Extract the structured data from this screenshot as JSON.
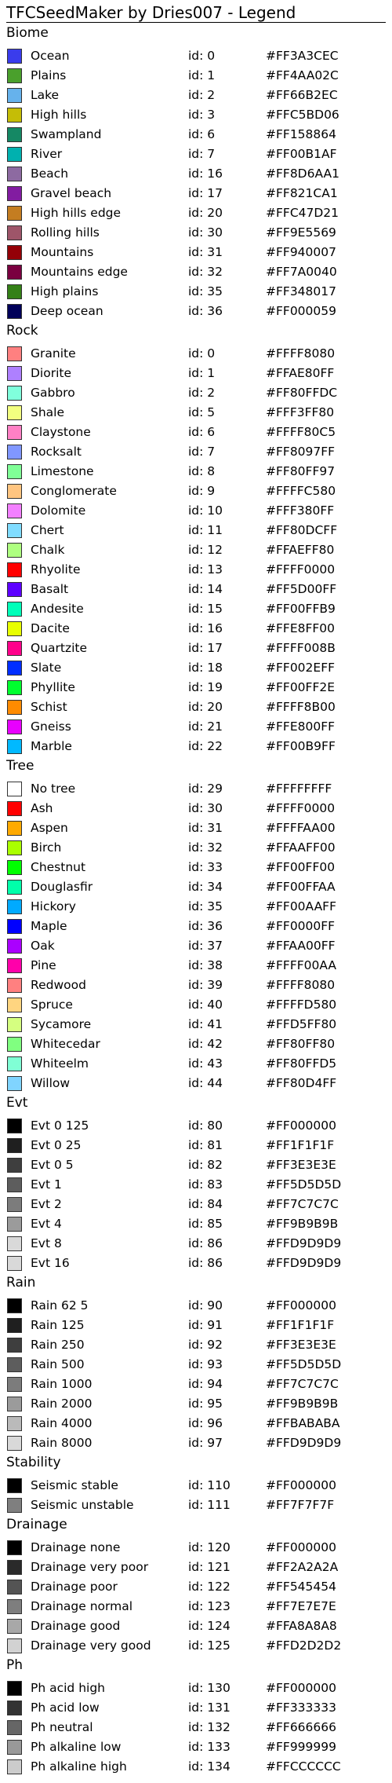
{
  "title": "TFCSeedMaker by Dries007 - Legend",
  "sections": [
    {
      "name": "Biome",
      "items": [
        {
          "name": "Ocean",
          "id": "id: 0",
          "hex": "#FF3A3CEC",
          "color": "#3A3CEC"
        },
        {
          "name": "Plains",
          "id": "id: 1",
          "hex": "#FF4AA02C",
          "color": "#4AA02C"
        },
        {
          "name": "Lake",
          "id": "id: 2",
          "hex": "#FF66B2EC",
          "color": "#66B2EC"
        },
        {
          "name": "High hills",
          "id": "id: 3",
          "hex": "#FFC5BD06",
          "color": "#C5BD06"
        },
        {
          "name": "Swampland",
          "id": "id: 6",
          "hex": "#FF158864",
          "color": "#158864"
        },
        {
          "name": "River",
          "id": "id: 7",
          "hex": "#FF00B1AF",
          "color": "#00B1AF"
        },
        {
          "name": "Beach",
          "id": "id: 16",
          "hex": "#FF8D6AA1",
          "color": "#8D6AA1"
        },
        {
          "name": "Gravel beach",
          "id": "id: 17",
          "hex": "#FF821CA1",
          "color": "#821CA1"
        },
        {
          "name": "High hills edge",
          "id": "id: 20",
          "hex": "#FFC47D21",
          "color": "#C47D21"
        },
        {
          "name": "Rolling hills",
          "id": "id: 30",
          "hex": "#FF9E5569",
          "color": "#9E5569"
        },
        {
          "name": "Mountains",
          "id": "id: 31",
          "hex": "#FF940007",
          "color": "#940007"
        },
        {
          "name": "Mountains edge",
          "id": "id: 32",
          "hex": "#FF7A0040",
          "color": "#7A0040"
        },
        {
          "name": "High plains",
          "id": "id: 35",
          "hex": "#FF348017",
          "color": "#348017"
        },
        {
          "name": "Deep ocean",
          "id": "id: 36",
          "hex": "#FF000059",
          "color": "#000059"
        }
      ]
    },
    {
      "name": "Rock",
      "items": [
        {
          "name": "Granite",
          "id": "id: 0",
          "hex": "#FFFF8080",
          "color": "#FF8080"
        },
        {
          "name": "Diorite",
          "id": "id: 1",
          "hex": "#FFAE80FF",
          "color": "#AE80FF"
        },
        {
          "name": "Gabbro",
          "id": "id: 2",
          "hex": "#FF80FFDC",
          "color": "#80FFDC"
        },
        {
          "name": "Shale",
          "id": "id: 5",
          "hex": "#FFF3FF80",
          "color": "#F3FF80"
        },
        {
          "name": "Claystone",
          "id": "id: 6",
          "hex": "#FFFF80C5",
          "color": "#FF80C5"
        },
        {
          "name": "Rocksalt",
          "id": "id: 7",
          "hex": "#FF8097FF",
          "color": "#8097FF"
        },
        {
          "name": "Limestone",
          "id": "id: 8",
          "hex": "#FF80FF97",
          "color": "#80FF97"
        },
        {
          "name": "Conglomerate",
          "id": "id: 9",
          "hex": "#FFFFC580",
          "color": "#FFC580"
        },
        {
          "name": "Dolomite",
          "id": "id: 10",
          "hex": "#FFF380FF",
          "color": "#F380FF"
        },
        {
          "name": "Chert",
          "id": "id: 11",
          "hex": "#FF80DCFF",
          "color": "#80DCFF"
        },
        {
          "name": "Chalk",
          "id": "id: 12",
          "hex": "#FFAEFF80",
          "color": "#AEFF80"
        },
        {
          "name": "Rhyolite",
          "id": "id: 13",
          "hex": "#FFFF0000",
          "color": "#FF0000"
        },
        {
          "name": "Basalt",
          "id": "id: 14",
          "hex": "#FF5D00FF",
          "color": "#5D00FF"
        },
        {
          "name": "Andesite",
          "id": "id: 15",
          "hex": "#FF00FFB9",
          "color": "#00FFB9"
        },
        {
          "name": "Dacite",
          "id": "id: 16",
          "hex": "#FFE8FF00",
          "color": "#E8FF00"
        },
        {
          "name": "Quartzite",
          "id": "id: 17",
          "hex": "#FFFF008B",
          "color": "#FF008B"
        },
        {
          "name": "Slate",
          "id": "id: 18",
          "hex": "#FF002EFF",
          "color": "#002EFF"
        },
        {
          "name": "Phyllite",
          "id": "id: 19",
          "hex": "#FF00FF2E",
          "color": "#00FF2E"
        },
        {
          "name": "Schist",
          "id": "id: 20",
          "hex": "#FFFF8B00",
          "color": "#FF8B00"
        },
        {
          "name": "Gneiss",
          "id": "id: 21",
          "hex": "#FFE800FF",
          "color": "#E800FF"
        },
        {
          "name": "Marble",
          "id": "id: 22",
          "hex": "#FF00B9FF",
          "color": "#00B9FF"
        }
      ]
    },
    {
      "name": "Tree",
      "items": [
        {
          "name": "No tree",
          "id": "id: 29",
          "hex": "#FFFFFFFF",
          "color": "#FFFFFF"
        },
        {
          "name": "Ash",
          "id": "id: 30",
          "hex": "#FFFF0000",
          "color": "#FF0000"
        },
        {
          "name": "Aspen",
          "id": "id: 31",
          "hex": "#FFFFAA00",
          "color": "#FFAA00"
        },
        {
          "name": "Birch",
          "id": "id: 32",
          "hex": "#FFAAFF00",
          "color": "#AAFF00"
        },
        {
          "name": "Chestnut",
          "id": "id: 33",
          "hex": "#FF00FF00",
          "color": "#00FF00"
        },
        {
          "name": "Douglasfir",
          "id": "id: 34",
          "hex": "#FF00FFAA",
          "color": "#00FFAA"
        },
        {
          "name": "Hickory",
          "id": "id: 35",
          "hex": "#FF00AAFF",
          "color": "#00AAFF"
        },
        {
          "name": "Maple",
          "id": "id: 36",
          "hex": "#FF0000FF",
          "color": "#0000FF"
        },
        {
          "name": "Oak",
          "id": "id: 37",
          "hex": "#FFAA00FF",
          "color": "#AA00FF"
        },
        {
          "name": "Pine",
          "id": "id: 38",
          "hex": "#FFFF00AA",
          "color": "#FF00AA"
        },
        {
          "name": "Redwood",
          "id": "id: 39",
          "hex": "#FFFF8080",
          "color": "#FF8080"
        },
        {
          "name": "Spruce",
          "id": "id: 40",
          "hex": "#FFFFD580",
          "color": "#FFD580"
        },
        {
          "name": "Sycamore",
          "id": "id: 41",
          "hex": "#FFD5FF80",
          "color": "#D5FF80"
        },
        {
          "name": "Whitecedar",
          "id": "id: 42",
          "hex": "#FF80FF80",
          "color": "#80FF80"
        },
        {
          "name": "Whiteelm",
          "id": "id: 43",
          "hex": "#FF80FFD5",
          "color": "#80FFD5"
        },
        {
          "name": "Willow",
          "id": "id: 44",
          "hex": "#FF80D4FF",
          "color": "#80D4FF"
        }
      ]
    },
    {
      "name": "Evt",
      "items": [
        {
          "name": "Evt 0 125",
          "id": "id: 80",
          "hex": "#FF000000",
          "color": "#000000"
        },
        {
          "name": "Evt 0 25",
          "id": "id: 81",
          "hex": "#FF1F1F1F",
          "color": "#1F1F1F"
        },
        {
          "name": "Evt 0 5",
          "id": "id: 82",
          "hex": "#FF3E3E3E",
          "color": "#3E3E3E"
        },
        {
          "name": "Evt 1",
          "id": "id: 83",
          "hex": "#FF5D5D5D",
          "color": "#5D5D5D"
        },
        {
          "name": "Evt 2",
          "id": "id: 84",
          "hex": "#FF7C7C7C",
          "color": "#7C7C7C"
        },
        {
          "name": "Evt 4",
          "id": "id: 85",
          "hex": "#FF9B9B9B",
          "color": "#9B9B9B"
        },
        {
          "name": "Evt 8",
          "id": "id: 86",
          "hex": "#FFD9D9D9",
          "color": "#D9D9D9"
        },
        {
          "name": "Evt 16",
          "id": "id: 86",
          "hex": "#FFD9D9D9",
          "color": "#D9D9D9"
        }
      ]
    },
    {
      "name": "Rain",
      "items": [
        {
          "name": "Rain 62 5",
          "id": "id: 90",
          "hex": "#FF000000",
          "color": "#000000"
        },
        {
          "name": "Rain 125",
          "id": "id: 91",
          "hex": "#FF1F1F1F",
          "color": "#1F1F1F"
        },
        {
          "name": "Rain 250",
          "id": "id: 92",
          "hex": "#FF3E3E3E",
          "color": "#3E3E3E"
        },
        {
          "name": "Rain 500",
          "id": "id: 93",
          "hex": "#FF5D5D5D",
          "color": "#5D5D5D"
        },
        {
          "name": "Rain 1000",
          "id": "id: 94",
          "hex": "#FF7C7C7C",
          "color": "#7C7C7C"
        },
        {
          "name": "Rain 2000",
          "id": "id: 95",
          "hex": "#FF9B9B9B",
          "color": "#9B9B9B"
        },
        {
          "name": "Rain 4000",
          "id": "id: 96",
          "hex": "#FFBABABA",
          "color": "#BABABA"
        },
        {
          "name": "Rain 8000",
          "id": "id: 97",
          "hex": "#FFD9D9D9",
          "color": "#D9D9D9"
        }
      ]
    },
    {
      "name": "Stability",
      "items": [
        {
          "name": "Seismic stable",
          "id": "id: 110",
          "hex": "#FF000000",
          "color": "#000000"
        },
        {
          "name": "Seismic unstable",
          "id": "id: 111",
          "hex": "#FF7F7F7F",
          "color": "#7F7F7F"
        }
      ]
    },
    {
      "name": "Drainage",
      "items": [
        {
          "name": "Drainage none",
          "id": "id: 120",
          "hex": "#FF000000",
          "color": "#000000"
        },
        {
          "name": "Drainage very poor",
          "id": "id: 121",
          "hex": "#FF2A2A2A",
          "color": "#2A2A2A"
        },
        {
          "name": "Drainage poor",
          "id": "id: 122",
          "hex": "#FF545454",
          "color": "#545454"
        },
        {
          "name": "Drainage normal",
          "id": "id: 123",
          "hex": "#FF7E7E7E",
          "color": "#7E7E7E"
        },
        {
          "name": "Drainage good",
          "id": "id: 124",
          "hex": "#FFA8A8A8",
          "color": "#A8A8A8"
        },
        {
          "name": "Drainage very good",
          "id": "id: 125",
          "hex": "#FFD2D2D2",
          "color": "#D2D2D2"
        }
      ]
    },
    {
      "name": "Ph",
      "items": [
        {
          "name": "Ph acid high",
          "id": "id: 130",
          "hex": "#FF000000",
          "color": "#000000"
        },
        {
          "name": "Ph acid low",
          "id": "id: 131",
          "hex": "#FF333333",
          "color": "#333333"
        },
        {
          "name": "Ph neutral",
          "id": "id: 132",
          "hex": "#FF666666",
          "color": "#666666"
        },
        {
          "name": "Ph alkaline low",
          "id": "id: 133",
          "hex": "#FF999999",
          "color": "#999999"
        },
        {
          "name": "Ph alkaline high",
          "id": "id: 134",
          "hex": "#FFCCCCCC",
          "color": "#CCCCCC"
        }
      ]
    }
  ]
}
